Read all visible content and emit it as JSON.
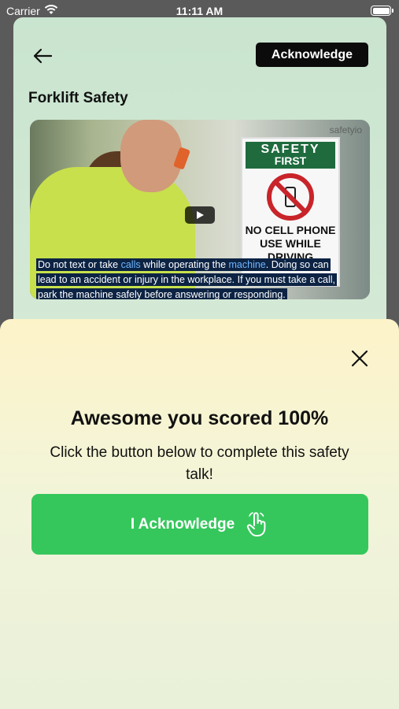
{
  "status_bar": {
    "carrier": "Carrier",
    "time": "11:11 AM"
  },
  "header": {
    "acknowledge_label": "Acknowledge",
    "page_title": "Forklift Safety"
  },
  "video": {
    "watermark": "safetyio",
    "sign": {
      "heading_line1": "SAFETY",
      "heading_line2": "FIRST",
      "body_line1": "NO CELL PHONE",
      "body_line2": "USE WHILE",
      "body_line3": "DRIVING"
    },
    "caption": {
      "line1_a": "Do not text or take ",
      "line1_hl1": "calls",
      "line1_b": " while operating the ",
      "line1_hl2": "machine",
      "line1_c": ". Doing so can",
      "line2": "lead to an accident or injury in the workplace.  If you must take a call,",
      "line3": "park the machine safely before answering or responding."
    }
  },
  "sheet": {
    "title": "Awesome you scored 100%",
    "message": "Click the button below to complete this safety talk!",
    "button_label": "I Acknowledge"
  },
  "colors": {
    "accent_green": "#35c75c",
    "card_bg": "#c9e4cf",
    "sheet_bg": "#fdf3c9"
  },
  "icons": [
    "wifi-icon",
    "battery-icon",
    "back-arrow-icon",
    "play-icon",
    "close-icon",
    "hand-pointer-icon"
  ]
}
